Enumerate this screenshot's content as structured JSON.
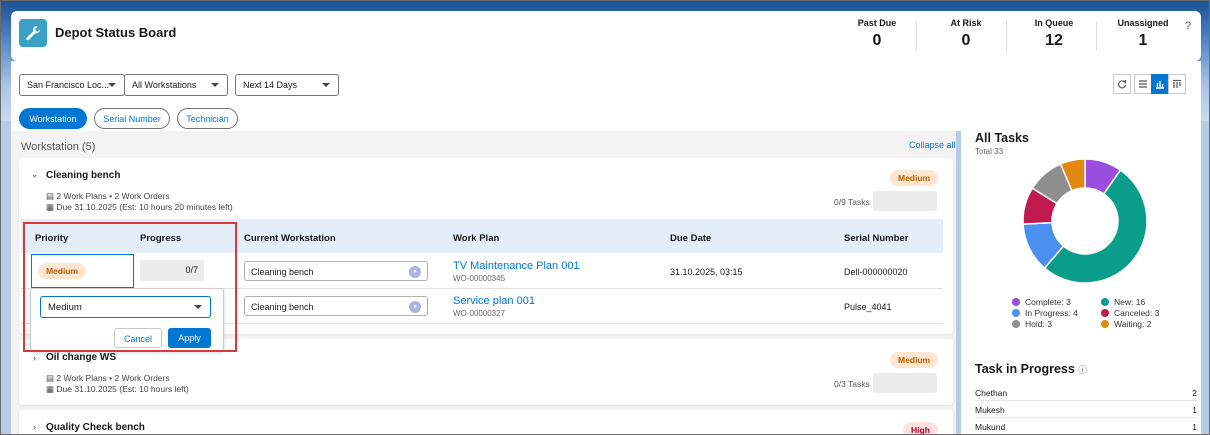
{
  "header": {
    "title": "Depot Status Board",
    "metrics": [
      {
        "label": "Past Due",
        "value": "0"
      },
      {
        "label": "At Risk",
        "value": "0"
      },
      {
        "label": "In Queue",
        "value": "12"
      },
      {
        "label": "Unassigned",
        "value": "1"
      }
    ],
    "help": "?"
  },
  "filters": {
    "location": "San Francisco Loc...",
    "workstations": "All Workstations",
    "range": "Next 14 Days"
  },
  "tabs": [
    "Workstation",
    "Serial Number",
    "Technician"
  ],
  "workstation_heading": "Workstation (5)",
  "collapse_all": "Collapse all",
  "cards": [
    {
      "title": "Cleaning bench",
      "meta1": "2 Work Plans • 2 Work Orders",
      "meta2": "Due 31.10.2025 (Est: 10 hours 20 minutes left)",
      "priority": "Medium",
      "tasks": "0/9 Tasks"
    },
    {
      "title": "Oil change WS",
      "meta1": "2 Work Plans • 2 Work Orders",
      "meta2": "Due 31.10.2025 (Est: 10 hours left)",
      "priority": "Medium",
      "tasks": "0/3 Tasks"
    },
    {
      "title": "Quality Check bench",
      "priority": "High"
    }
  ],
  "table": {
    "headers": [
      "Priority",
      "Progress",
      "Current Workstation",
      "Work Plan",
      "Due Date",
      "Serial Number"
    ],
    "rows": [
      {
        "priority": "Medium",
        "progress": "0/7",
        "workstation": "Cleaning bench",
        "plan": "TV Maintenance Plan 001",
        "plan_id": "WO-00000345",
        "due": "31.10.2025, 03:15",
        "serial": "Dell-000000020"
      },
      {
        "workstation": "Cleaning bench",
        "plan": "Service plan 001",
        "plan_id": "WO-00000327",
        "serial": "Pulse_4041"
      }
    ]
  },
  "editor": {
    "value": "Medium",
    "cancel": "Cancel",
    "apply": "Apply"
  },
  "all_tasks": {
    "title": "All Tasks",
    "total": "Total 33",
    "legend": [
      {
        "label": "Complete: 3",
        "color": "#9b4de0"
      },
      {
        "label": "New: 16",
        "color": "#0a9e8a"
      },
      {
        "label": "In Progress: 4",
        "color": "#4a90f0"
      },
      {
        "label": "Canceled: 3",
        "color": "#c01a4f"
      },
      {
        "label": "Hold: 3",
        "color": "#8f8f8f"
      },
      {
        "label": "Waiting: 2",
        "color": "#e0880f"
      }
    ]
  },
  "chart_data": {
    "type": "pie",
    "categories": [
      "Complete",
      "New",
      "In Progress",
      "Canceled",
      "Hold",
      "Waiting"
    ],
    "values": [
      3,
      16,
      4,
      3,
      3,
      2
    ],
    "colors": [
      "#9b4de0",
      "#0a9e8a",
      "#4a90f0",
      "#c01a4f",
      "#8f8f8f",
      "#e0880f"
    ],
    "title": "All Tasks",
    "subtitle": "Total 33",
    "legend": "bottom"
  },
  "task_in_progress": {
    "title": "Task in Progress",
    "rows": [
      {
        "name": "Chethan",
        "value": "2"
      },
      {
        "name": "Mukesh",
        "value": "1"
      },
      {
        "name": "Mukund",
        "value": "1"
      }
    ]
  }
}
